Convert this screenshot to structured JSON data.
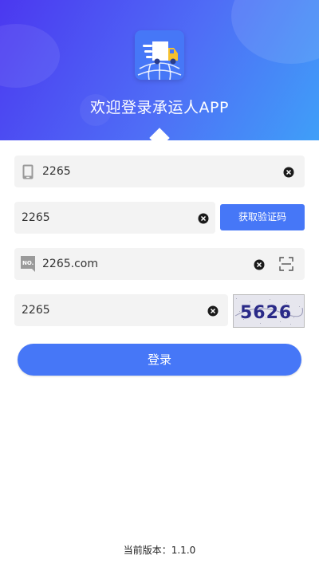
{
  "header": {
    "title": "欢迎登录承运人APP",
    "icon": "truck-globe-icon",
    "gradient": [
      "#4b38f0",
      "#3f9ff8"
    ]
  },
  "form": {
    "phone": {
      "value": "2265",
      "icon": "phone-icon"
    },
    "sms_code": {
      "value": "2265",
      "button_label": "获取验证码"
    },
    "server": {
      "value": "2265.com",
      "icon": "number-badge-icon",
      "badge_text": "NO."
    },
    "captcha": {
      "value": "2265",
      "image_text": "5626"
    }
  },
  "login": {
    "label": "登录"
  },
  "footer": {
    "version_label": "当前版本：",
    "version": "1.1.0"
  },
  "colors": {
    "accent": "#4677f7",
    "field_bg": "#f3f3f3"
  }
}
